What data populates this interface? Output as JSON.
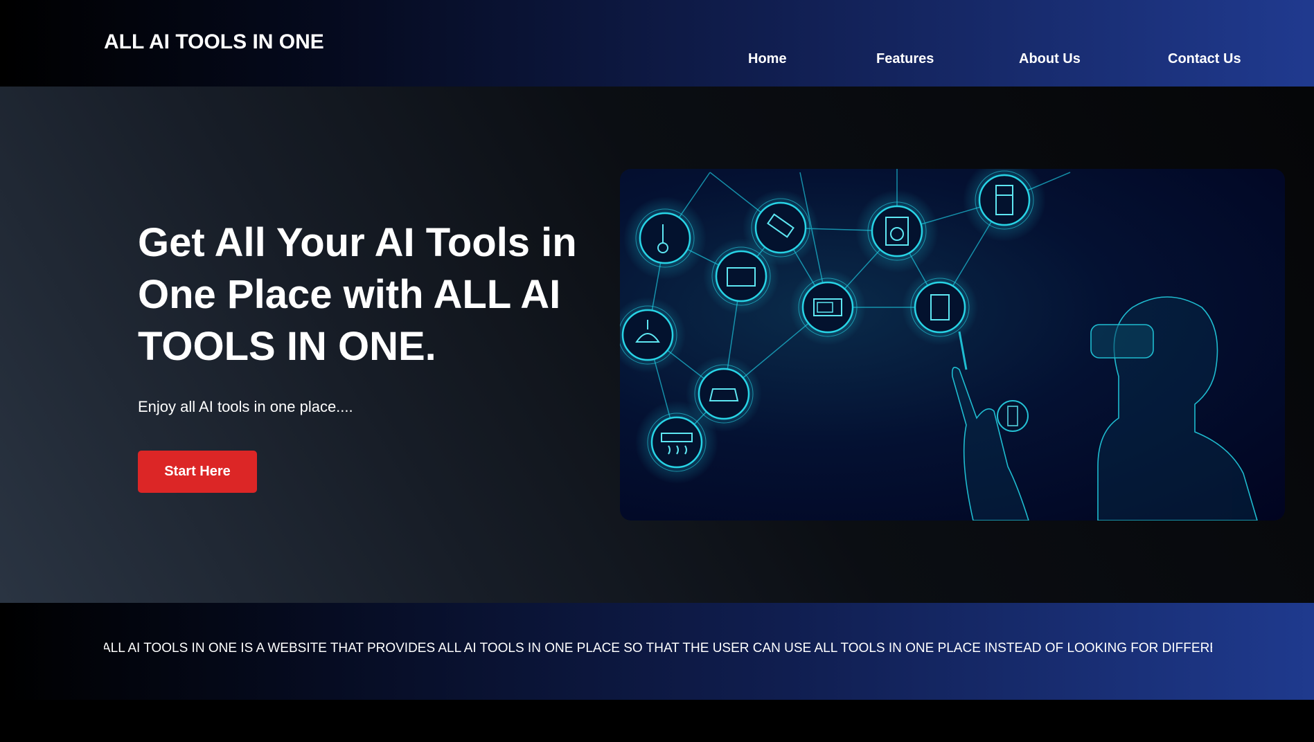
{
  "header": {
    "logo": "ALL AI TOOLS IN ONE",
    "nav": [
      "Home",
      "Features",
      "About Us",
      "Contact Us"
    ]
  },
  "hero": {
    "headline": "Get All Your AI Tools in One Place with ALL AI TOOLS IN ONE.",
    "subtext": "Enjoy all AI tools in one place....",
    "cta_label": "Start Here"
  },
  "ticker": {
    "text": "ALL AI TOOLS IN ONE IS A WEBSITE THAT PROVIDES ALL AI TOOLS IN ONE PLACE SO THAT THE USER CAN USE ALL TOOLS IN ONE PLACE INSTEAD OF LOOKING FOR DIFFERENT WEBSITES"
  },
  "colors": {
    "accent": "#dc2626",
    "header_gradient_end": "#203a8f",
    "glow": "#19c3d6"
  },
  "image": {
    "icons": [
      "lamp-icon",
      "key-icon",
      "tv-icon",
      "cctv-camera-icon",
      "microwave-icon",
      "washing-machine-icon",
      "coffee-machine-icon",
      "fridge-icon",
      "car-icon",
      "air-conditioner-icon",
      "vr-headset-person"
    ]
  }
}
